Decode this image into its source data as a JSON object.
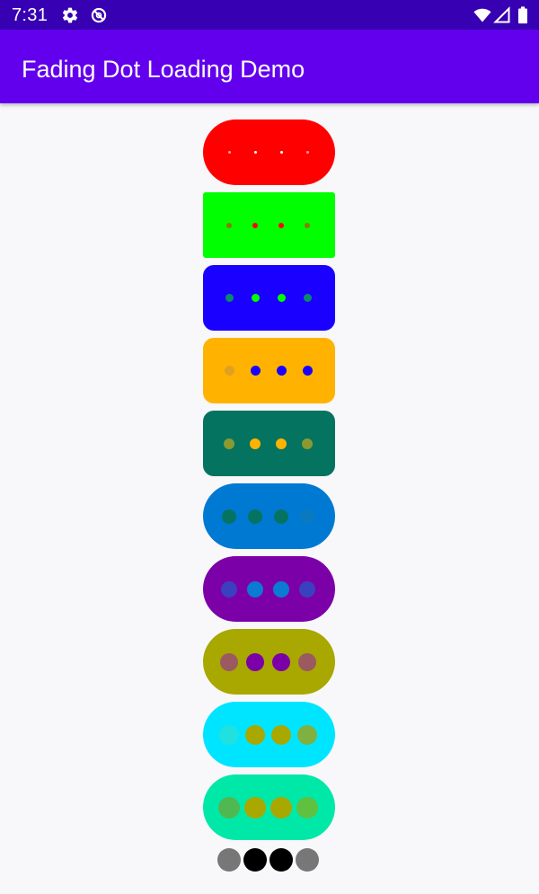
{
  "status_bar": {
    "time": "7:31",
    "bg_color": "#3700b3",
    "icons": [
      "settings-icon",
      "sync-disabled-icon",
      "wifi-icon",
      "signal-icon",
      "battery-icon"
    ]
  },
  "app_bar": {
    "title": "Fading Dot Loading Demo",
    "bg_color": "#6200ee"
  },
  "loaders": [
    {
      "name": "loader-red",
      "bg": "#ff0000",
      "shape": "pill",
      "dots": [
        {
          "color": "#ff9a9a"
        },
        {
          "color": "#ffffff"
        },
        {
          "color": "#ffffff"
        },
        {
          "color": "#ff9a9a"
        }
      ]
    },
    {
      "name": "loader-green",
      "bg": "#00ff00",
      "shape": "square",
      "dots": [
        {
          "color": "#8a7a00"
        },
        {
          "color": "#ff0000"
        },
        {
          "color": "#ff0000"
        },
        {
          "color": "#8a7a00"
        }
      ]
    },
    {
      "name": "loader-blue",
      "bg": "#1a00ff",
      "shape": "rounded",
      "dots": [
        {
          "color": "#0a8a6a"
        },
        {
          "color": "#00ff00"
        },
        {
          "color": "#00ff00"
        },
        {
          "color": "#0a8a6a"
        }
      ]
    },
    {
      "name": "loader-amber",
      "bg": "#ffb300",
      "shape": "rounded",
      "dots": [
        {
          "color": "#e0a020"
        },
        {
          "color": "#1a00ff"
        },
        {
          "color": "#1a00ff"
        },
        {
          "color": "#1a00ff"
        }
      ]
    },
    {
      "name": "loader-teal",
      "bg": "#047360",
      "shape": "rounded",
      "dots": [
        {
          "color": "#8a9a30"
        },
        {
          "color": "#ffb300"
        },
        {
          "color": "#ffb300"
        },
        {
          "color": "#8a9a30"
        }
      ]
    },
    {
      "name": "loader-azure",
      "bg": "#0079d3",
      "shape": "pill",
      "dots": [
        {
          "color": "#047360"
        },
        {
          "color": "#047360"
        },
        {
          "color": "#047360"
        },
        {
          "color": "#0a7ac0"
        }
      ]
    },
    {
      "name": "loader-purple",
      "bg": "#7b00a8",
      "shape": "pill",
      "dots": [
        {
          "color": "#3a40c0"
        },
        {
          "color": "#0a7ad3"
        },
        {
          "color": "#0a7ad3"
        },
        {
          "color": "#3a40c0"
        }
      ]
    },
    {
      "name": "loader-olive",
      "bg": "#a8a800",
      "shape": "pill",
      "dots": [
        {
          "color": "#9a5a60"
        },
        {
          "color": "#7b00a8"
        },
        {
          "color": "#7b00a8"
        },
        {
          "color": "#9a5a60"
        }
      ]
    },
    {
      "name": "loader-cyan",
      "bg": "#00e5ff",
      "shape": "pill",
      "dots": [
        {
          "color": "#20e0e0"
        },
        {
          "color": "#a8a800"
        },
        {
          "color": "#a8a800"
        },
        {
          "color": "#80b040"
        }
      ]
    },
    {
      "name": "loader-mint",
      "bg": "#00e8a8",
      "shape": "pill",
      "dots": [
        {
          "color": "#50b850"
        },
        {
          "color": "#a8a800"
        },
        {
          "color": "#a8a800"
        },
        {
          "color": "#60c040"
        }
      ]
    },
    {
      "name": "loader-plain",
      "bg": "",
      "shape": "none",
      "dots": [
        {
          "color": "#777777"
        },
        {
          "color": "#000000"
        },
        {
          "color": "#000000"
        },
        {
          "color": "#777777"
        }
      ]
    }
  ]
}
